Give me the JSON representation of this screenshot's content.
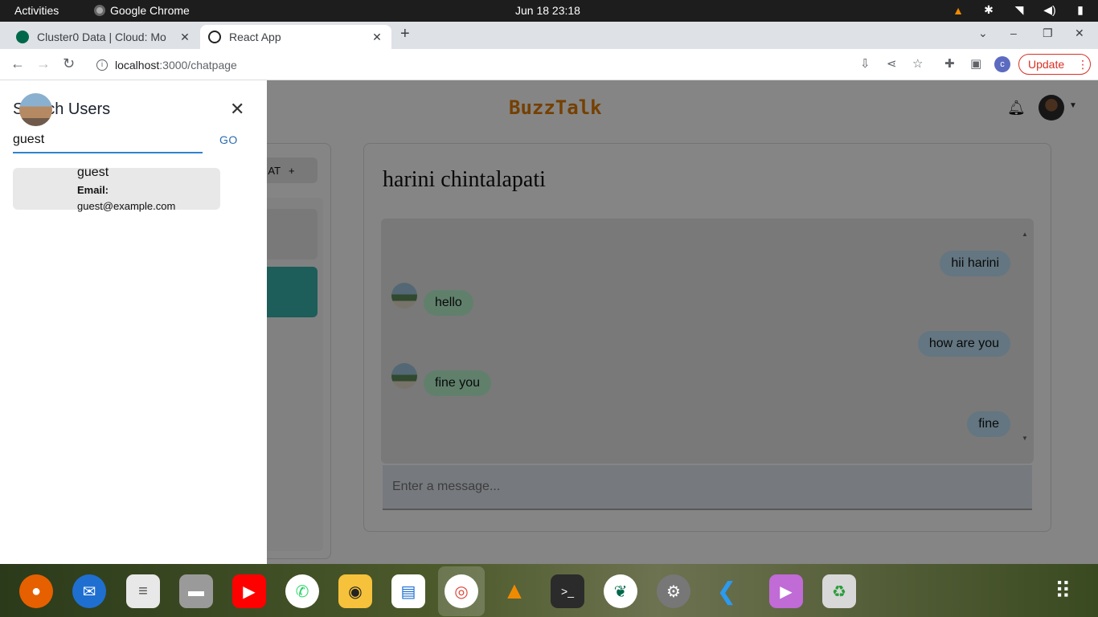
{
  "topbar": {
    "activities": "Activities",
    "app": "Google Chrome",
    "clock": "Jun 18  23:18"
  },
  "browser": {
    "tabs": [
      {
        "label": "Cluster0 Data | Cloud: Mo",
        "active": false
      },
      {
        "label": "React App",
        "active": true
      }
    ],
    "url_host": "localhost",
    "url_path": ":3000/chatpage",
    "profile_letter": "c",
    "update_label": "Update"
  },
  "app": {
    "brand": "BuzzTalk",
    "new_group_label": "AT",
    "chat_title": "harini chintalapati",
    "messages": [
      {
        "text": "hii harini",
        "side": "sent"
      },
      {
        "text": "hello",
        "side": "recv"
      },
      {
        "text": "how are you",
        "side": "sent"
      },
      {
        "text": "fine you",
        "side": "recv"
      },
      {
        "text": "fine",
        "side": "sent"
      }
    ],
    "message_placeholder": "Enter a message..."
  },
  "drawer": {
    "title": "Search Users",
    "search_value": "guest",
    "go_label": "GO",
    "results": [
      {
        "name": "guest",
        "email_label": "Email:",
        "email": "guest@example.com"
      }
    ]
  },
  "dock": {
    "apps": [
      "firefox-icon",
      "thunderbird-icon",
      "text-editor-icon",
      "files-icon",
      "youtube-icon",
      "whatsapp-icon",
      "rhythmbox-icon",
      "writer-icon",
      "chrome-icon",
      "vlc-icon",
      "terminal-icon",
      "mongodb-compass-icon",
      "settings-icon",
      "vscode-icon",
      "media-player-icon",
      "trash-icon",
      "show-apps-icon"
    ]
  },
  "colors": {
    "brand": "#e07b00",
    "accent": "#3182ce",
    "sent_bubble": "#bee3f8",
    "recv_bubble": "#b9f5d0",
    "teal": "#38b2ac",
    "update": "#d93025"
  }
}
